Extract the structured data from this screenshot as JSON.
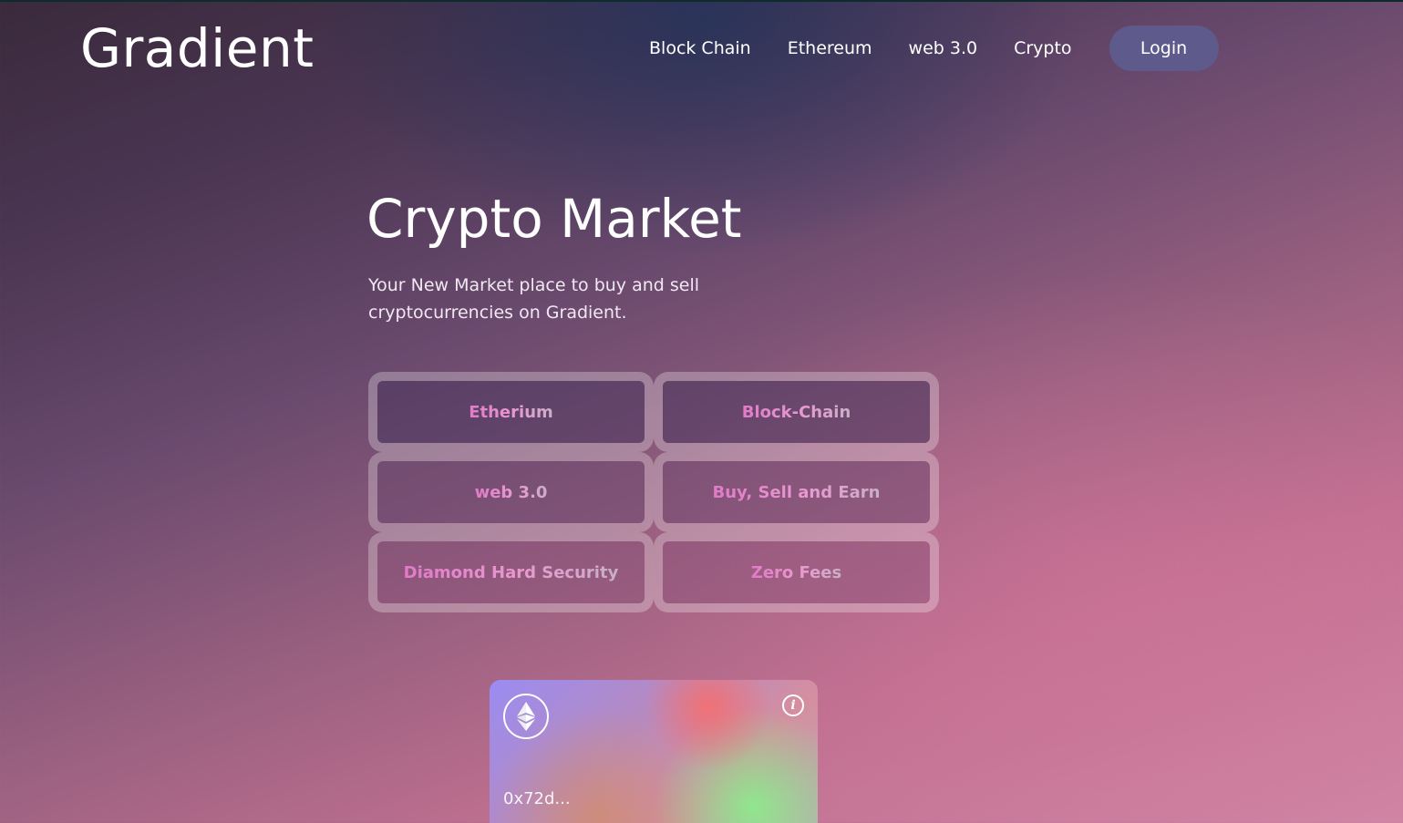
{
  "header": {
    "brand": "Gradient",
    "nav": [
      "Block Chain",
      "Ethereum",
      "web 3.0",
      "Crypto"
    ],
    "login_label": "Login"
  },
  "hero": {
    "title": "Crypto Market",
    "subtitle": "Your New Market place to buy and sell cryptocurrencies on Gradient."
  },
  "features": [
    "Etherium",
    "Block-Chain",
    "web 3.0",
    "Buy, Sell and Earn",
    "Diamond Hard Security",
    "Zero Fees"
  ],
  "card": {
    "icon": "ethereum-icon",
    "info_icon": "info-icon",
    "address": "0x72d..."
  },
  "colors": {
    "login_bg": "#5f5a8c",
    "accent_pink": "#e07ac8"
  }
}
